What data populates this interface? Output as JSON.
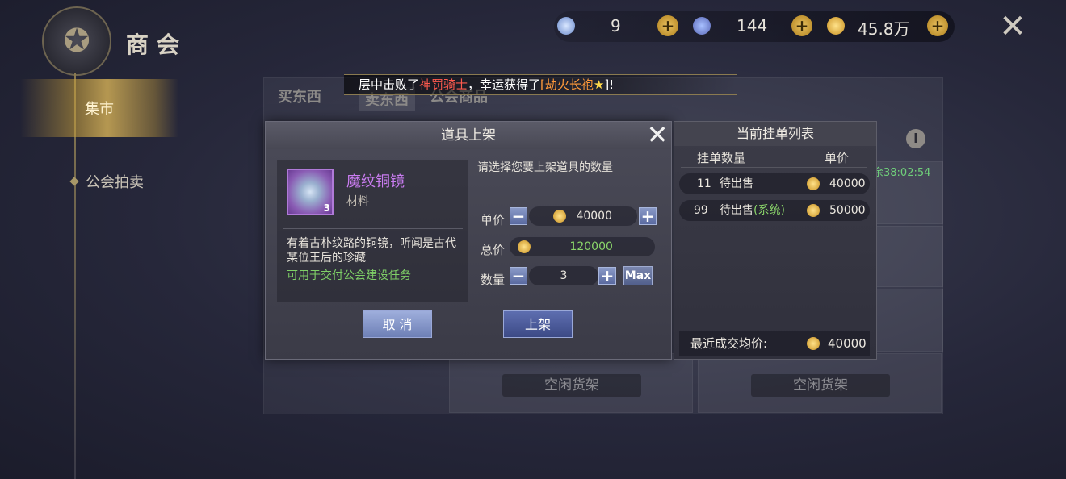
{
  "guild": {
    "title": "商会",
    "emblem_icon": "guild-emblem-icon"
  },
  "nav": {
    "items": [
      {
        "label": "集市",
        "active": true
      },
      {
        "label": "公会拍卖",
        "active": false
      }
    ]
  },
  "currency": {
    "diamond": "9",
    "gem": "144",
    "gold": "45.8万"
  },
  "tabs": [
    "买东西",
    "卖东西",
    "公会商品"
  ],
  "news": {
    "prefix": "层中击败了",
    "boss": "神罚骑士",
    "mid": "，幸运获得了",
    "item": "[劫火长袍",
    "star": "★",
    "suffix": "]!"
  },
  "shelves": {
    "idle_label": "空闲货架",
    "timer": "剩余38:02:54"
  },
  "dialog": {
    "title": "道具上架",
    "item": {
      "name": "魔纹铜镜",
      "type": "材料",
      "count": "3",
      "desc": "有着古朴纹路的铜镜，听闻是古代某位王后的珍藏",
      "use": "可用于交付公会建设任务"
    },
    "prompt": "请选择您要上架道具的数量",
    "price_label": "单价",
    "price_value": "40000",
    "total_label": "总价",
    "total_value": "120000",
    "qty_label": "数量",
    "qty_value": "3",
    "max_label": "Max",
    "cancel_label": "取 消",
    "list_label": "上架"
  },
  "orders": {
    "title": "当前挂单列表",
    "col_qty": "挂单数量",
    "col_price": "单价",
    "rows": [
      {
        "qty": "11",
        "status": "待出售",
        "system": "",
        "price": "40000"
      },
      {
        "qty": "99",
        "status": "待出售",
        "system": "(系统)",
        "price": "50000"
      }
    ],
    "avg_label": "最近成交均价:",
    "avg_value": "40000"
  },
  "colors": {
    "accent_gold": "#e8c060",
    "item_purple": "#c97cf0",
    "note_green": "#7fd067",
    "news_red": "#ff5a4e",
    "news_orange": "#ff9a3a"
  }
}
